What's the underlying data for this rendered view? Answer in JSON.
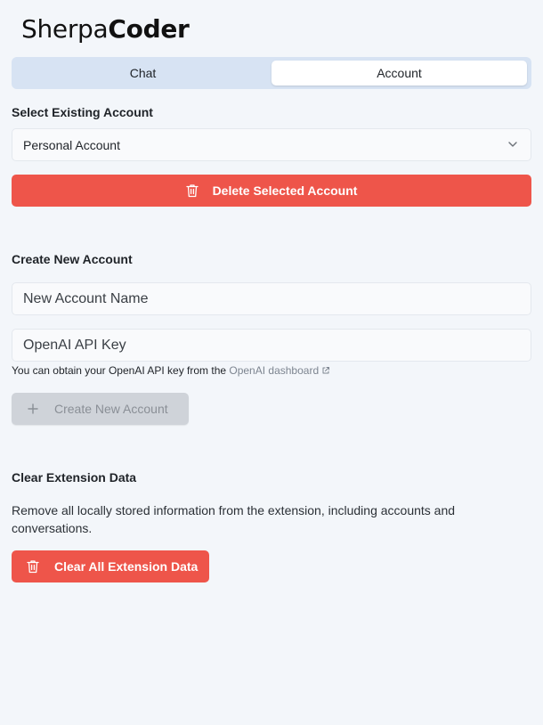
{
  "logo": {
    "light": "Sherpa",
    "bold": "Coder"
  },
  "tabs": [
    {
      "label": "Chat",
      "active": false
    },
    {
      "label": "Account",
      "active": true
    }
  ],
  "select_account": {
    "title": "Select Existing Account",
    "selected": "Personal Account",
    "delete_label": "Delete Selected Account"
  },
  "create_account": {
    "title": "Create New Account",
    "name_placeholder": "New Account Name",
    "key_placeholder": "OpenAI API Key",
    "hint_prefix": "You can obtain your OpenAI API key from the ",
    "hint_link": "OpenAI dashboard",
    "button_label": "Create New Account"
  },
  "clear_data": {
    "title": "Clear Extension Data",
    "description": "Remove all locally stored information from the extension, including accounts and conversations.",
    "button_label": "Clear All Extension Data"
  },
  "icons": {
    "delete": "trash-icon",
    "select": "chevron-down-icon",
    "link": "external-link-icon",
    "create": "plus-icon",
    "clear": "trash-icon"
  },
  "colors": {
    "danger": "#ee554a",
    "active_tab": "#ffffff",
    "tab_bar": "#d7e3f3",
    "background": "#f3f6fa",
    "disabled_button": "#cfd3d9"
  }
}
